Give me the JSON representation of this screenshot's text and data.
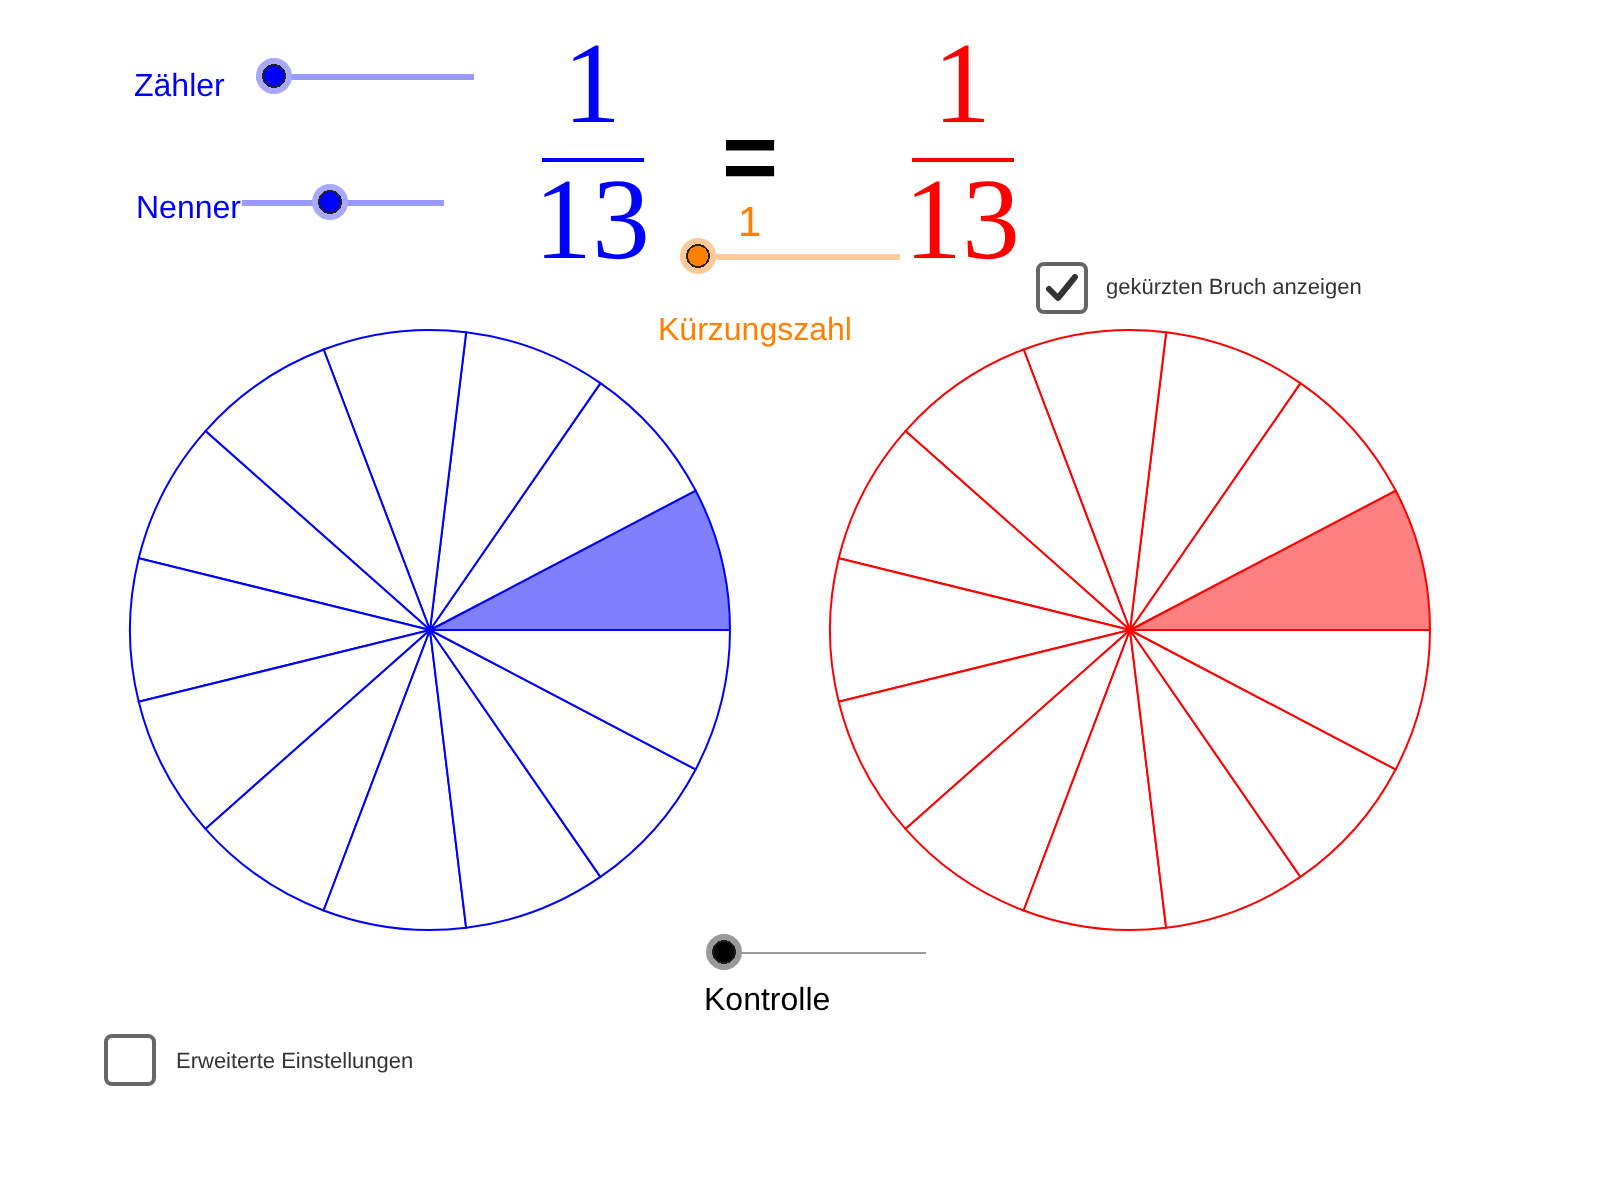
{
  "zaehler_slider": {
    "label": "Zähler",
    "level": 0
  },
  "nenner_slider": {
    "label": "Nenner",
    "level": 0.42
  },
  "fraction_left": {
    "numerator": "1",
    "denominator": "13"
  },
  "equals": "=",
  "fraction_right": {
    "numerator": "1",
    "denominator": "13"
  },
  "kuerzungszahl_slider": {
    "value": "1",
    "label": "Kürzungszahl",
    "level": 0
  },
  "show_reduced_checkbox": {
    "label": "gekürzten Bruch anzeigen",
    "checked": true
  },
  "circle_left": {
    "sectors": [
      {
        "filled": true
      },
      {
        "filled": false
      },
      {
        "filled": false
      },
      {
        "filled": false
      },
      {
        "filled": false
      },
      {
        "filled": false
      },
      {
        "filled": false
      },
      {
        "filled": false
      },
      {
        "filled": false
      },
      {
        "filled": false
      },
      {
        "filled": false
      },
      {
        "filled": false
      },
      {
        "filled": false
      }
    ]
  },
  "circle_right": {
    "sectors": [
      {
        "filled": true
      },
      {
        "filled": false
      },
      {
        "filled": false
      },
      {
        "filled": false
      },
      {
        "filled": false
      },
      {
        "filled": false
      },
      {
        "filled": false
      },
      {
        "filled": false
      },
      {
        "filled": false
      },
      {
        "filled": false
      },
      {
        "filled": false
      },
      {
        "filled": false
      },
      {
        "filled": false
      }
    ]
  },
  "kontrolle_slider": {
    "label": "Kontrolle",
    "level": 0
  },
  "advanced_settings_checkbox": {
    "label": "Erweiterte Einstellungen",
    "checked": false
  }
}
